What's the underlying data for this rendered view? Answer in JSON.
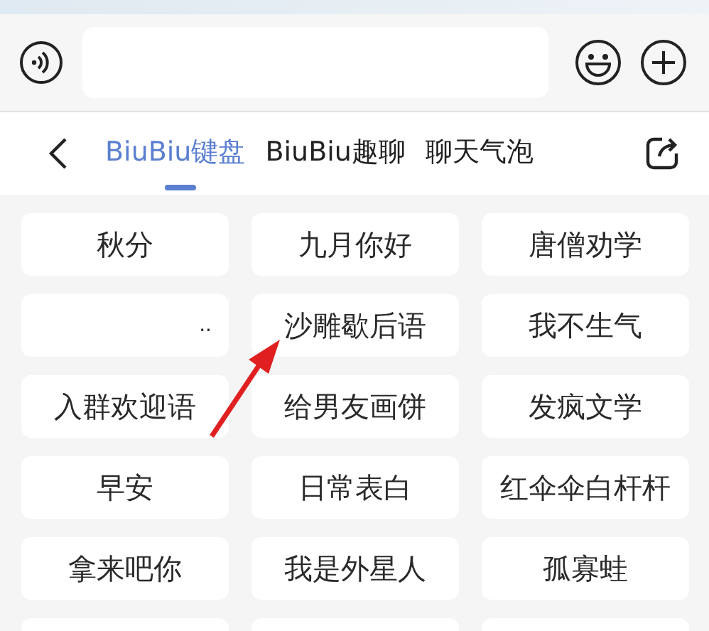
{
  "tabs": [
    {
      "label": "BiuBiu键盘",
      "selected": true
    },
    {
      "label": "BiuBiu趣聊",
      "selected": false
    },
    {
      "label": "聊天气泡",
      "selected": false
    }
  ],
  "phrases": [
    {
      "label": "秋分"
    },
    {
      "label": "九月你好"
    },
    {
      "label": "唐僧劝学"
    },
    {
      "label": ".."
    },
    {
      "label": "沙雕歇后语"
    },
    {
      "label": "我不生气"
    },
    {
      "label": "入群欢迎语"
    },
    {
      "label": "给男友画饼"
    },
    {
      "label": "发疯文学"
    },
    {
      "label": "早安"
    },
    {
      "label": "日常表白"
    },
    {
      "label": "红伞伞白杆杆"
    },
    {
      "label": "拿来吧你"
    },
    {
      "label": "我是外星人"
    },
    {
      "label": "孤寡蛙"
    }
  ]
}
